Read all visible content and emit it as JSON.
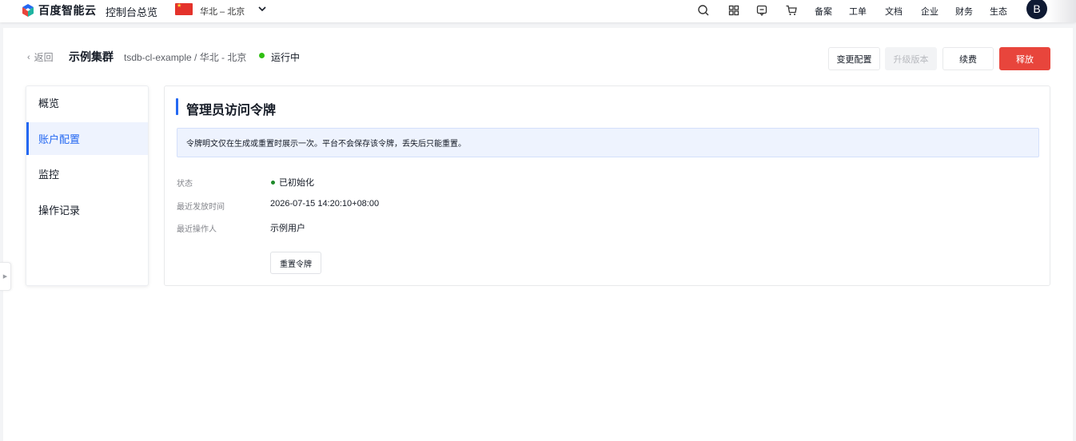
{
  "topbar": {
    "logo_text": "百度智能云",
    "console_label": "控制台总览",
    "region": "华北 – 北京",
    "links": [
      "备案",
      "工单",
      "文档",
      "企业",
      "财务",
      "生态"
    ],
    "avatar_letter": "B"
  },
  "header": {
    "back_label": "返回",
    "cluster_name": "示例集群",
    "cluster_path": "tsdb-cl-example / 华北 - 北京",
    "status": "运行中",
    "status_color": "#30bf13",
    "buttons": {
      "change_config": "变更配置",
      "upgrade": "升级版本",
      "renew": "续费",
      "release": "释放"
    }
  },
  "sidemenu": {
    "items": [
      "概览",
      "账户配置",
      "监控",
      "操作记录"
    ],
    "active_index": 1
  },
  "card": {
    "title": "管理员访问令牌",
    "notice": "令牌明文仅在生成或重置时展示一次。平台不会保存该令牌，丢失后只能重置。",
    "fields": [
      {
        "label": "状态",
        "value": "已初始化"
      },
      {
        "label": "最近发放时间",
        "value": "2026-07-15 14:20:10+08:00"
      },
      {
        "label": "最近操作人",
        "value": "示例用户"
      }
    ],
    "reset_button": "重置令牌"
  },
  "colors": {
    "accent": "#2468f2",
    "danger": "#e8453c"
  }
}
